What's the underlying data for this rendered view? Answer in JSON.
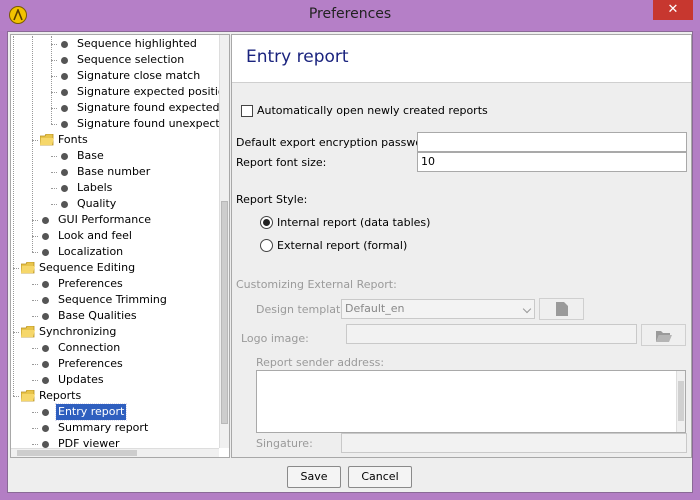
{
  "window": {
    "title": "Preferences",
    "close_glyph": "✕"
  },
  "tree": {
    "items": [
      {
        "label": "Sequence highlighted",
        "kind": "leaf",
        "level": 3
      },
      {
        "label": "Sequence selection",
        "kind": "leaf",
        "level": 3
      },
      {
        "label": "Signature close match",
        "kind": "leaf",
        "level": 3
      },
      {
        "label": "Signature expected position",
        "kind": "leaf",
        "level": 3
      },
      {
        "label": "Signature found expected",
        "kind": "leaf",
        "level": 3
      },
      {
        "label": "Signature found unexpected",
        "kind": "leaf",
        "level": 3
      },
      {
        "label": "Fonts",
        "kind": "folder",
        "level": 2
      },
      {
        "label": "Base",
        "kind": "leaf",
        "level": 3
      },
      {
        "label": "Base number",
        "kind": "leaf",
        "level": 3
      },
      {
        "label": "Labels",
        "kind": "leaf",
        "level": 3
      },
      {
        "label": "Quality",
        "kind": "leaf",
        "level": 3
      },
      {
        "label": "GUI Performance",
        "kind": "leaf",
        "level": 2
      },
      {
        "label": "Look and feel",
        "kind": "leaf",
        "level": 2
      },
      {
        "label": "Localization",
        "kind": "leaf",
        "level": 2
      },
      {
        "label": "Sequence Editing",
        "kind": "folder",
        "level": 1
      },
      {
        "label": "Preferences",
        "kind": "leaf",
        "level": 2
      },
      {
        "label": "Sequence Trimming",
        "kind": "leaf",
        "level": 2
      },
      {
        "label": "Base Qualities",
        "kind": "leaf",
        "level": 2
      },
      {
        "label": "Synchronizing",
        "kind": "folder",
        "level": 1
      },
      {
        "label": "Connection",
        "kind": "leaf",
        "level": 2
      },
      {
        "label": "Preferences",
        "kind": "leaf",
        "level": 2
      },
      {
        "label": "Updates",
        "kind": "leaf",
        "level": 2
      },
      {
        "label": "Reports",
        "kind": "folder",
        "level": 1
      },
      {
        "label": "Entry report",
        "kind": "leaf",
        "level": 2,
        "selected": true
      },
      {
        "label": "Summary report",
        "kind": "leaf",
        "level": 2
      },
      {
        "label": "PDF viewer",
        "kind": "leaf",
        "level": 2
      }
    ]
  },
  "content": {
    "title": "Entry report",
    "auto_open_label": "Automatically open newly created reports",
    "auto_open_checked": false,
    "password_label": "Default export encryption password:",
    "password_value": "",
    "font_size_label": "Report font size:",
    "font_size_value": "10",
    "style_label": "Report Style:",
    "style_internal_label": "Internal report (data tables)",
    "style_external_label": "External report (formal)",
    "style_selected": "internal",
    "customizing_label": "Customizing External Report:",
    "design_template_label": "Design template:",
    "design_template_value": "Default_en",
    "logo_label": "Logo image:",
    "logo_value": "",
    "sender_label": "Report sender address:",
    "sender_value": "",
    "signature_label": "Singature:",
    "signature_value": ""
  },
  "buttons": {
    "save_label": "Save",
    "cancel_label": "Cancel"
  },
  "colors": {
    "titlebar": "#b57fc7",
    "close": "#c7372f",
    "selection": "#2f5fbf",
    "title_text": "#1a237e",
    "folder": "#e8c44a"
  }
}
